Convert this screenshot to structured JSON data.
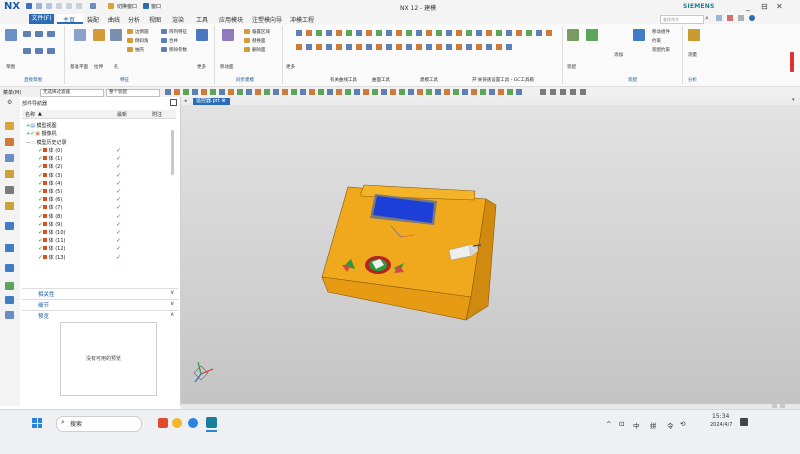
{
  "app": {
    "logo": "NX",
    "window_title": "NX 12 - 建模",
    "brand": "SIEMENS",
    "window_controls": [
      "_",
      "⊟",
      "✕"
    ],
    "quick_access": [
      "window-menu-icon",
      "window-menu-label"
    ],
    "quick_window_label": "切换窗口",
    "quick_window_menu": "窗口"
  },
  "menu": {
    "file": "文件(F)",
    "items": [
      "主页",
      "装配",
      "曲线",
      "分析",
      "视图",
      "渲染",
      "工具",
      "应用模块",
      "注塑模向导",
      "冲模工程"
    ],
    "search_placeholder": "查找命令"
  },
  "ribbon": {
    "groups": [
      {
        "name": "直接草图",
        "labels": [
          "草图"
        ]
      },
      {
        "name": "特征",
        "labels": [
          "基准平面",
          "拉伸",
          "孔",
          "边倒圆",
          "倒斜角",
          "抽壳",
          "阵列特征",
          "合并",
          "移除参数",
          "更多"
        ]
      },
      {
        "name": "同步建模",
        "labels": [
          "移动面",
          "偏置区域",
          "替换面",
          "删除面"
        ]
      },
      {
        "name": "",
        "labels": [
          "更多"
        ]
      },
      {
        "name": "装配",
        "labels": [
          "装配",
          "添加",
          "移动组件",
          "约束",
          "装配约束"
        ]
      },
      {
        "name": "分析",
        "labels": [
          "测量"
        ]
      }
    ],
    "sub_group_labels": [
      "曲线",
      "编辑曲面",
      "曲面",
      "同步建模"
    ],
    "sub_group_labels_2": [
      "有关曲线工具",
      "曲面工具",
      "建模工具",
      "开'关快速设置工具 - GC工具箱"
    ]
  },
  "toolbar2": {
    "menu_label": "菜单(M)",
    "filter": "无选择过滤器",
    "assembly": "整个装配"
  },
  "nav": {
    "title": "部件导航器",
    "columns": [
      "名称",
      "最新",
      "附注"
    ],
    "nodes": [
      "模型视图",
      "摄像机",
      "模型历史记录"
    ],
    "features": [
      "体 (0)",
      "体 (1)",
      "体 (2)",
      "体 (3)",
      "体 (4)",
      "体 (5)",
      "体 (6)",
      "体 (7)",
      "体 (8)",
      "体 (9)",
      "体 (10)",
      "体 (11)",
      "体 (12)",
      "体 (13)"
    ],
    "sections": [
      "相关性",
      "细节",
      "预览"
    ],
    "preview_empty": "没有可用的预览"
  },
  "tab": {
    "label": "遥控器.prt ⊗ ×"
  },
  "taskbar": {
    "search_placeholder": "搜索",
    "tray": [
      "^",
      "⊡",
      "中",
      "拼",
      "令",
      "⟲"
    ],
    "time": "15:34",
    "date": "2024/4/7"
  },
  "colors": {
    "accent": "#2b6cb8",
    "body": "#f0a81c",
    "screen": "#1c3fd8"
  }
}
